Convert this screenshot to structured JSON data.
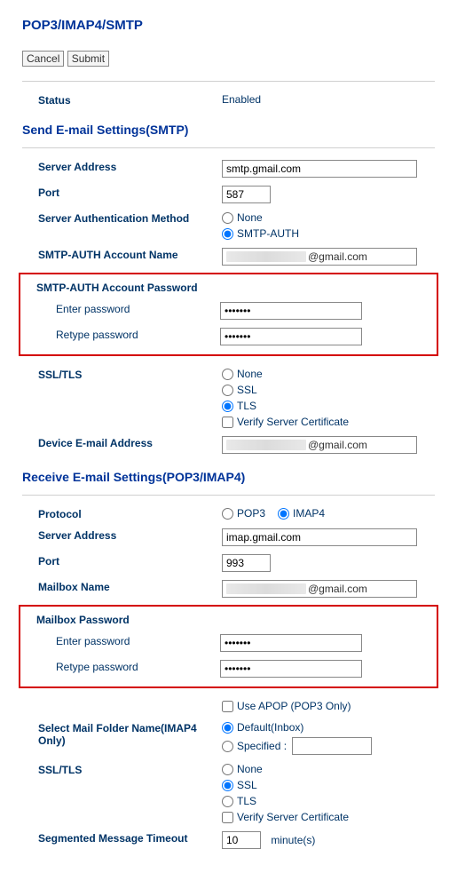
{
  "title": "POP3/IMAP4/SMTP",
  "buttons": {
    "cancel": "Cancel",
    "submit": "Submit"
  },
  "status": {
    "label": "Status",
    "value": "Enabled"
  },
  "smtp": {
    "header": "Send E-mail Settings(SMTP)",
    "server_address_label": "Server Address",
    "server_address_value": "smtp.gmail.com",
    "port_label": "Port",
    "port_value": "587",
    "auth_method_label": "Server Authentication Method",
    "auth_none": "None",
    "auth_smtp": "SMTP-AUTH",
    "account_name_label": "SMTP-AUTH Account Name",
    "account_domain": "@gmail.com",
    "password_header": "SMTP-AUTH Account Password",
    "enter_pw_label": "Enter password",
    "retype_pw_label": "Retype password",
    "ssl_label": "SSL/TLS",
    "ssl_none": "None",
    "ssl_ssl": "SSL",
    "ssl_tls": "TLS",
    "verify_cert": "Verify Server Certificate",
    "device_email_label": "Device E-mail Address",
    "device_email_domain": "@gmail.com"
  },
  "recv": {
    "header": "Receive E-mail Settings(POP3/IMAP4)",
    "protocol_label": "Protocol",
    "protocol_pop3": "POP3",
    "protocol_imap4": "IMAP4",
    "server_address_label": "Server Address",
    "server_address_value": "imap.gmail.com",
    "port_label": "Port",
    "port_value": "993",
    "mailbox_name_label": "Mailbox Name",
    "mailbox_domain": "@gmail.com",
    "password_header": "Mailbox Password",
    "enter_pw_label": "Enter password",
    "retype_pw_label": "Retype password",
    "use_apop": "Use APOP (POP3 Only)",
    "folder_label": "Select Mail Folder Name(IMAP4 Only)",
    "folder_default": "Default(Inbox)",
    "folder_specified": "Specified :",
    "ssl_label": "SSL/TLS",
    "ssl_none": "None",
    "ssl_ssl": "SSL",
    "ssl_tls": "TLS",
    "verify_cert": "Verify Server Certificate",
    "timeout_label": "Segmented Message Timeout",
    "timeout_value": "10",
    "timeout_unit": "minute(s)"
  },
  "pw_mask": "•••••••"
}
